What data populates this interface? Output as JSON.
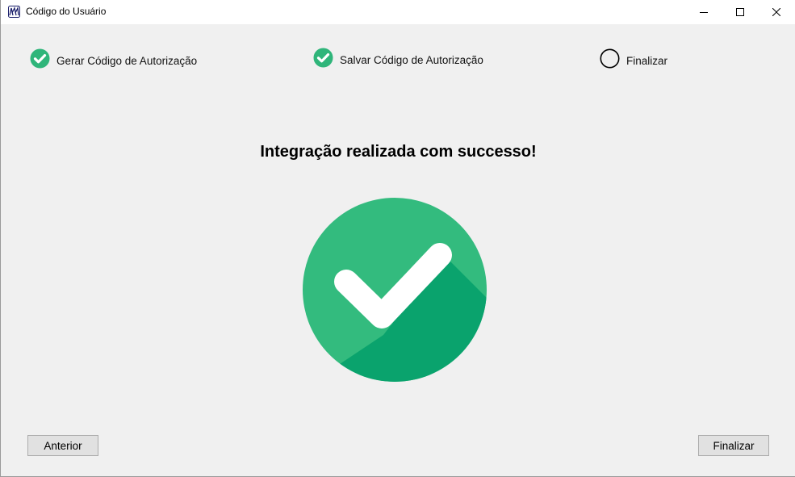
{
  "window": {
    "title": "Código do Usuário",
    "app_icon": "app-logo-icon",
    "controls": {
      "minimize": "minimize-icon",
      "maximize": "maximize-icon",
      "close": "close-icon"
    }
  },
  "steps": [
    {
      "label": "Gerar Código de Autorização",
      "status": "completed",
      "icon": "check-circle-icon"
    },
    {
      "label": "Salvar Código de Autorização",
      "status": "completed",
      "icon": "check-circle-icon"
    },
    {
      "label": "Finalizar",
      "status": "pending",
      "icon": "empty-circle-icon"
    }
  ],
  "main": {
    "heading": "Integração realizada com successo!",
    "graphic_icon": "success-check-icon"
  },
  "footer": {
    "previous_label": "Anterior",
    "finish_label": "Finalizar"
  },
  "colors": {
    "success_green": "#33bb7e",
    "success_shadow": "#0aa36d",
    "step_check_green": "#2fb57a",
    "background": "#f0f0f0"
  }
}
